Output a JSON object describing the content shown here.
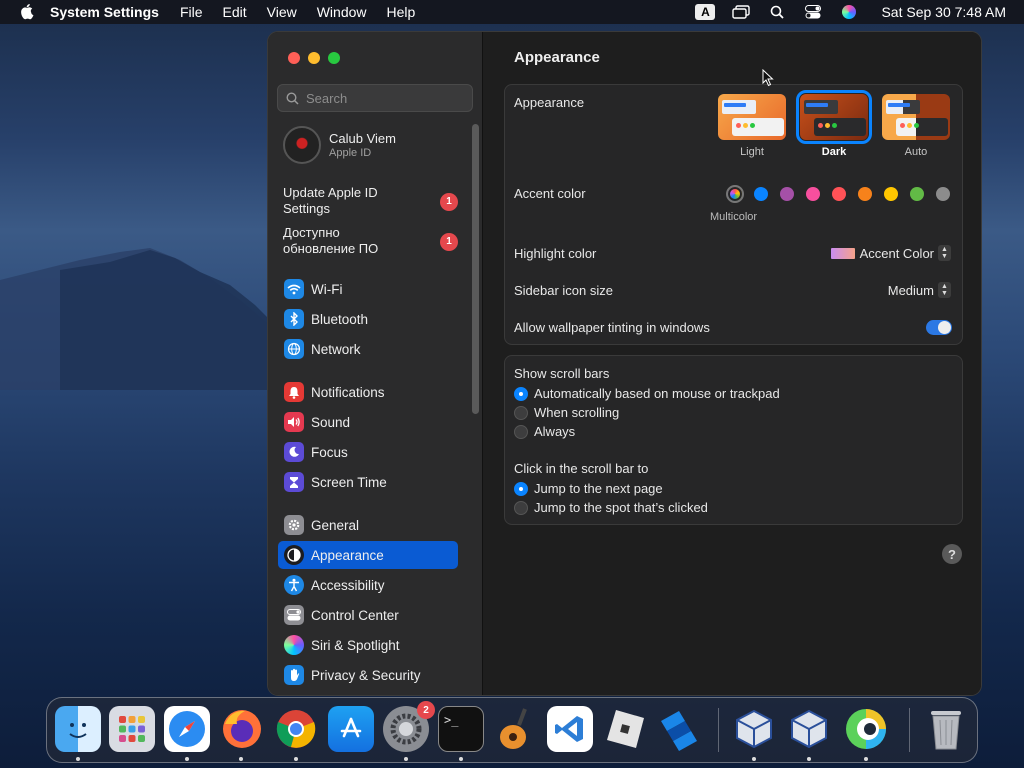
{
  "menubar": {
    "app_name": "System Settings",
    "menus": [
      "File",
      "Edit",
      "View",
      "Window",
      "Help"
    ],
    "input_source": "A",
    "clock": "Sat Sep 30  7:48 AM"
  },
  "sidebar": {
    "search_placeholder": "Search",
    "profile": {
      "name": "Calub Viem",
      "subtitle": "Apple ID"
    },
    "alerts": [
      {
        "label": "Update Apple ID Settings",
        "badge": "1"
      },
      {
        "label": "Доступно обновление ПО",
        "badge": "1"
      }
    ],
    "items": [
      {
        "label": "Wi-Fi",
        "icon": "wifi-icon",
        "color": "#1e88e5"
      },
      {
        "label": "Bluetooth",
        "icon": "bluetooth-icon",
        "color": "#1e88e5"
      },
      {
        "label": "Network",
        "icon": "globe-icon",
        "color": "#1e88e5"
      },
      {
        "label": "Notifications",
        "icon": "bell-icon",
        "color": "#e53935"
      },
      {
        "label": "Sound",
        "icon": "speaker-icon",
        "color": "#e53950"
      },
      {
        "label": "Focus",
        "icon": "moon-icon",
        "color": "#5c4bd6"
      },
      {
        "label": "Screen Time",
        "icon": "hourglass-icon",
        "color": "#5c4bd6"
      },
      {
        "label": "General",
        "icon": "gear-icon",
        "color": "#8e8e93"
      },
      {
        "label": "Appearance",
        "icon": "appearance-icon",
        "color": "#1c1c1e"
      },
      {
        "label": "Accessibility",
        "icon": "accessibility-icon",
        "color": "#1e88e5"
      },
      {
        "label": "Control Center",
        "icon": "control-center-icon",
        "color": "#8e8e93"
      },
      {
        "label": "Siri & Spotlight",
        "icon": "siri-icon",
        "color": "#7b3fd6"
      },
      {
        "label": "Privacy & Security",
        "icon": "hand-icon",
        "color": "#1e88e5"
      }
    ],
    "active": "Appearance"
  },
  "content": {
    "title": "Appearance",
    "appearance_label": "Appearance",
    "themes": [
      {
        "label": "Light",
        "selected": false
      },
      {
        "label": "Dark",
        "selected": true
      },
      {
        "label": "Auto",
        "selected": false
      }
    ],
    "accent_label": "Accent color",
    "accent_selected_name": "Multicolor",
    "accent_colors": [
      "#bf5af2",
      "#0a84ff",
      "#a550a7",
      "#f74f9e",
      "#ff5257",
      "#f7821b",
      "#ffc600",
      "#62ba46",
      "#8c8c8c"
    ],
    "highlight_label": "Highlight color",
    "highlight_value": "Accent Color",
    "sidebar_icon_label": "Sidebar icon size",
    "sidebar_icon_value": "Medium",
    "tinting_label": "Allow wallpaper tinting in windows",
    "tinting_on": true,
    "scroll_bars_label": "Show scroll bars",
    "scroll_bar_options": [
      {
        "label": "Automatically based on mouse or trackpad",
        "selected": true
      },
      {
        "label": "When scrolling",
        "selected": false
      },
      {
        "label": "Always",
        "selected": false
      }
    ],
    "click_label": "Click in the scroll bar to",
    "click_options": [
      {
        "label": "Jump to the next page",
        "selected": true
      },
      {
        "label": "Jump to the spot that’s clicked",
        "selected": false
      }
    ],
    "help": "?"
  },
  "dock": {
    "apps": [
      {
        "name": "finder-icon",
        "running": true
      },
      {
        "name": "launchpad-icon",
        "running": false
      },
      {
        "name": "safari-icon",
        "running": true
      },
      {
        "name": "firefox-icon",
        "running": true
      },
      {
        "name": "chrome-icon",
        "running": true
      },
      {
        "name": "app-store-icon",
        "running": false
      },
      {
        "name": "system-settings-icon",
        "running": true,
        "badge": "2"
      },
      {
        "name": "terminal-icon",
        "running": true
      },
      {
        "name": "garageband-icon",
        "running": false
      },
      {
        "name": "vscode-icon",
        "running": false
      },
      {
        "name": "roblox-icon",
        "running": false
      },
      {
        "name": "roblox-studio-icon",
        "running": false
      },
      {
        "name": "virtualbox-icon",
        "running": true
      },
      {
        "name": "virtualbox-vm-icon",
        "running": true
      },
      {
        "name": "webex-icon",
        "running": true
      },
      {
        "name": "trash-icon",
        "running": false
      }
    ]
  }
}
